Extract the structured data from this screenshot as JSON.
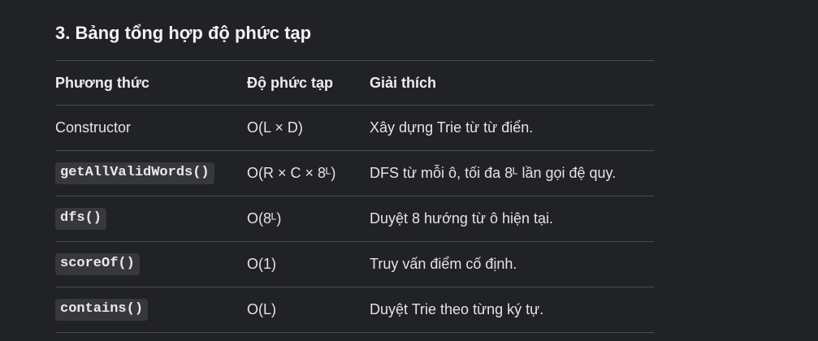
{
  "section": {
    "heading": "3. Bảng tổng hợp độ phức tạp"
  },
  "table": {
    "headers": [
      "Phương thức",
      "Độ phức tạp",
      "Giải thích"
    ],
    "rows": [
      {
        "method": "Constructor",
        "is_code": false,
        "complexity": "O(L × D)",
        "explanation": "Xây dựng Trie từ từ điển."
      },
      {
        "method": "getAllValidWords()",
        "is_code": true,
        "complexity": "O(R × C × 8ᴸ)",
        "explanation": "DFS từ mỗi ô, tối đa 8ᴸ lần gọi đệ quy."
      },
      {
        "method": "dfs()",
        "is_code": true,
        "complexity": "O(8ᴸ)",
        "explanation": "Duyệt 8 hướng từ ô hiện tại."
      },
      {
        "method": "scoreOf()",
        "is_code": true,
        "complexity": "O(1)",
        "explanation": "Truy vấn điểm cố định."
      },
      {
        "method": "contains()",
        "is_code": true,
        "complexity": "O(L)",
        "explanation": "Duyệt Trie theo từng ký tự."
      }
    ]
  }
}
